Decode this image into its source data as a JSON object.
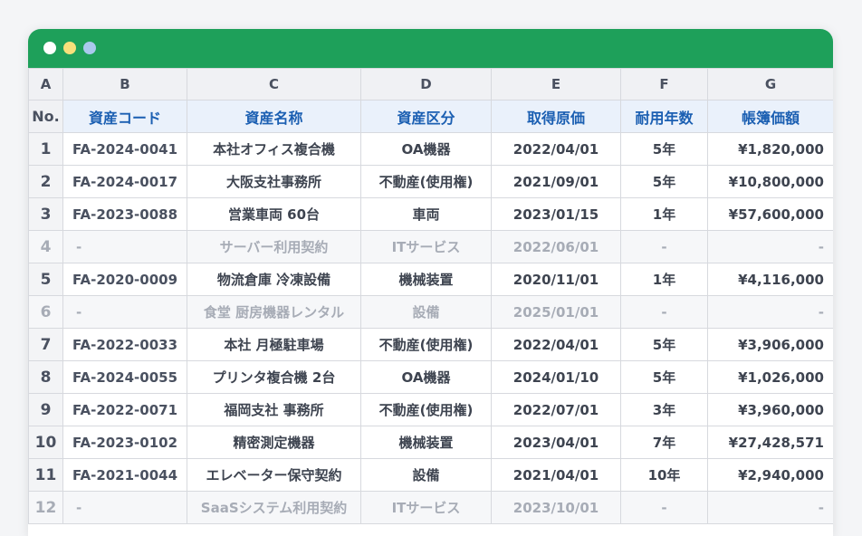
{
  "window_dots": [
    "close-dot",
    "minimize-dot",
    "maximize-dot"
  ],
  "column_letters": [
    "A",
    "B",
    "C",
    "D",
    "E",
    "F",
    "G"
  ],
  "headers": [
    "No.",
    "資産コード",
    "資産名称",
    "資産区分",
    "取得原価",
    "耐用年数",
    "帳簿価額"
  ],
  "rows": [
    {
      "no": "1",
      "code": "FA-2024-0041",
      "name": "本社オフィス複合機",
      "category": "OA機器",
      "date": "2022/04/01",
      "life": "5年",
      "value": "¥1,820,000",
      "dim": false
    },
    {
      "no": "2",
      "code": "FA-2024-0017",
      "name": "大阪支社事務所",
      "category": "不動産(使用権)",
      "date": "2021/09/01",
      "life": "5年",
      "value": "¥10,800,000",
      "dim": false
    },
    {
      "no": "3",
      "code": "FA-2023-0088",
      "name": "営業車両 60台",
      "category": "車両",
      "date": "2023/01/15",
      "life": "1年",
      "value": "¥57,600,000",
      "dim": false
    },
    {
      "no": "4",
      "code": "-",
      "name": "サーバー利用契約",
      "category": "ITサービス",
      "date": "2022/06/01",
      "life": "-",
      "value": "-",
      "dim": true
    },
    {
      "no": "5",
      "code": "FA-2020-0009",
      "name": "物流倉庫 冷凍設備",
      "category": "機械装置",
      "date": "2020/11/01",
      "life": "1年",
      "value": "¥4,116,000",
      "dim": false
    },
    {
      "no": "6",
      "code": "-",
      "name": "食堂 厨房機器レンタル",
      "category": "設備",
      "date": "2025/01/01",
      "life": "-",
      "value": "-",
      "dim": true
    },
    {
      "no": "7",
      "code": "FA-2022-0033",
      "name": "本社 月極駐車場",
      "category": "不動産(使用権)",
      "date": "2022/04/01",
      "life": "5年",
      "value": "¥3,906,000",
      "dim": false
    },
    {
      "no": "8",
      "code": "FA-2024-0055",
      "name": "プリンタ複合機 2台",
      "category": "OA機器",
      "date": "2024/01/10",
      "life": "5年",
      "value": "¥1,026,000",
      "dim": false
    },
    {
      "no": "9",
      "code": "FA-2022-0071",
      "name": "福岡支社 事務所",
      "category": "不動産(使用権)",
      "date": "2022/07/01",
      "life": "3年",
      "value": "¥3,960,000",
      "dim": false
    },
    {
      "no": "10",
      "code": "FA-2023-0102",
      "name": "精密測定機器",
      "category": "機械装置",
      "date": "2023/04/01",
      "life": "7年",
      "value": "¥27,428,571",
      "dim": false
    },
    {
      "no": "11",
      "code": "FA-2021-0044",
      "name": "エレベーター保守契約",
      "category": "設備",
      "date": "2021/04/01",
      "life": "10年",
      "value": "¥2,940,000",
      "dim": false
    },
    {
      "no": "12",
      "code": "-",
      "name": "SaaSシステム利用契約",
      "category": "ITサービス",
      "date": "2023/10/01",
      "life": "-",
      "value": "-",
      "dim": true
    }
  ]
}
